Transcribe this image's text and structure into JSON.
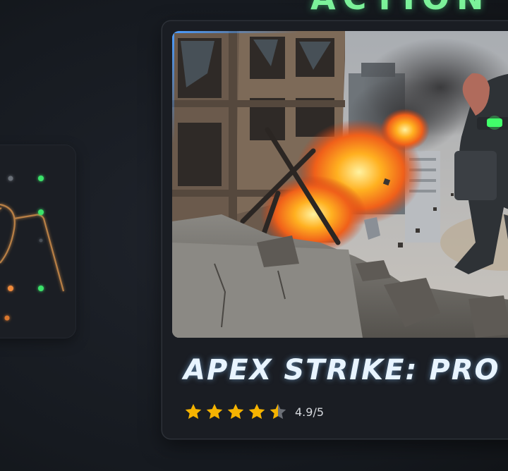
{
  "section": {
    "title": "ACTION"
  },
  "game": {
    "title": "APEX STRIKE: PRO",
    "rating": 4.5,
    "rating_text": "4.9/5",
    "accent_color": "#4a9cff",
    "star_color": "#f5b301"
  },
  "side_card": {
    "icon": "controller-circuit-icon"
  }
}
